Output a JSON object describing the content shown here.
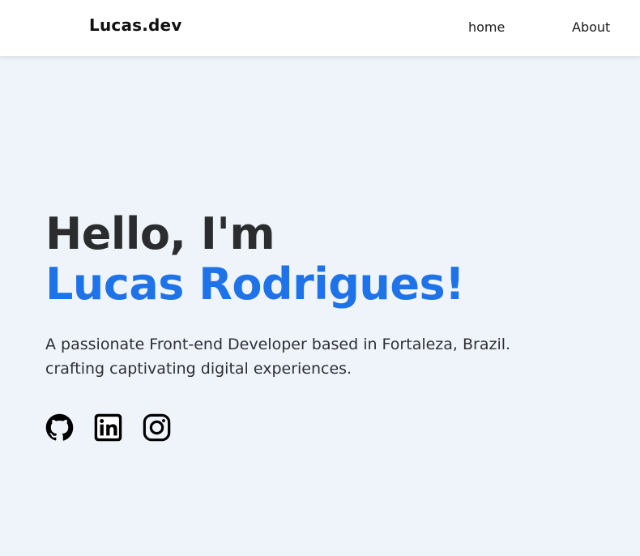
{
  "navbar": {
    "logo": "Lucas.dev",
    "links": [
      {
        "label": "home"
      },
      {
        "label": "About"
      }
    ]
  },
  "hero": {
    "greeting": "Hello, I'm",
    "name": "Lucas Rodrigues!",
    "description_line1": "A passionate Front-end Developer based in Fortaleza, Brazil.",
    "description_line2": "crafting captivating digital experiences."
  },
  "socials": [
    {
      "icon": "github-icon"
    },
    {
      "icon": "linkedin-icon"
    },
    {
      "icon": "instagram-icon"
    }
  ],
  "colors": {
    "background": "#eff4fb",
    "navbar": "#ffffff",
    "accent": "#1f73e8",
    "heading": "#2a2c2e",
    "text": "#2e3033"
  }
}
